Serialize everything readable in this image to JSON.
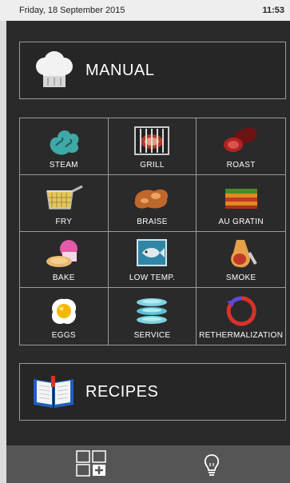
{
  "status_bar": {
    "date": "Friday, 18 September 2015",
    "time": "11:53"
  },
  "manual": {
    "label": "MANUAL",
    "icon": "chef-hat-icon"
  },
  "modes": [
    {
      "label": "STEAM",
      "icon": "steam-icon"
    },
    {
      "label": "GRILL",
      "icon": "grill-icon"
    },
    {
      "label": "ROAST",
      "icon": "roast-icon"
    },
    {
      "label": "FRY",
      "icon": "fry-basket-icon"
    },
    {
      "label": "BRAISE",
      "icon": "braise-icon"
    },
    {
      "label": "AU GRATIN",
      "icon": "au-gratin-icon"
    },
    {
      "label": "BAKE",
      "icon": "bake-icon"
    },
    {
      "label": "LOW TEMP.",
      "icon": "low-temp-fish-icon"
    },
    {
      "label": "SMOKE",
      "icon": "smoke-ham-icon"
    },
    {
      "label": "EGGS",
      "icon": "egg-icon"
    },
    {
      "label": "SERVICE",
      "icon": "service-plates-icon"
    },
    {
      "label": "RETHERMALIZATION",
      "icon": "rethermalization-icon"
    }
  ],
  "recipes": {
    "label": "RECIPES",
    "icon": "book-icon"
  },
  "bottom_bar": {
    "grid_add_icon": "grid-add-icon",
    "tip_icon": "lightbulb-icon"
  },
  "colors": {
    "panel": "#2a2a2a",
    "border": "#9a9a9a",
    "bottom_bar": "#555555",
    "status_bar": "#eeeeee"
  }
}
